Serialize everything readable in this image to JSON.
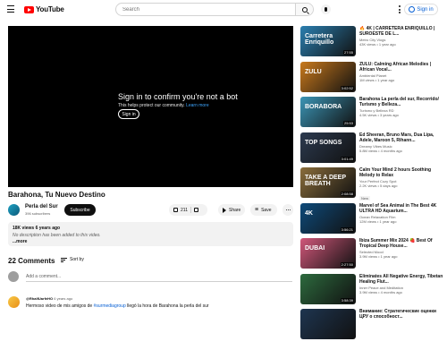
{
  "header": {
    "logo_text": "YouTube",
    "search_placeholder": "Search",
    "signin_label": "Sign in"
  },
  "player": {
    "message_title": "Sign in to confirm you're not a bot",
    "message_sub": "This helps protect our community.",
    "learn_more": "Learn more",
    "signin_button": "Sign in"
  },
  "video": {
    "title": "Barahona, Tu Nuevo Destino",
    "channel_name": "Perla del Sur",
    "channel_subs": "396 subscribers",
    "subscribe_label": "Subscribe",
    "likes": "211",
    "share_label": "Share",
    "save_label": "Save"
  },
  "description": {
    "meta": "18K views  6 years ago",
    "text": "No description has been added to this video.",
    "more": "...more"
  },
  "comments": {
    "count_label": "22 Comments",
    "sort_label": "Sort by",
    "add_placeholder": "Add a comment...",
    "first": {
      "author": "@RhalfUarfeHO",
      "when": "6 years ago",
      "text_before": "Hermoso video de mis amigos de ",
      "tag": "#surmediagroup",
      "text_after": " llegó la hora de Barahona la perla del sur"
    }
  },
  "recommendations": [
    {
      "title": "🔥 4K | CARRETERA ENRIQUILLO | SUROESTE DE L...",
      "channel": "Metro City Vlogs",
      "stats": "43K views • 1 year ago",
      "duration": "27:55",
      "thumb_label": "Carretera Enriquillo",
      "thumb_color": "#2b7fb0"
    },
    {
      "title": "ZULU: Calming African Melodies | African Vocal...",
      "channel": "Ambiental Planet",
      "stats": "1M views • 1 year ago",
      "duration": "3:02:52",
      "thumb_label": "ZULU",
      "thumb_color": "#c9791c"
    },
    {
      "title": "Barahona La perla del sur, Recorrido/ Turismo y Belleza...",
      "channel": "Turismo y Belleza RD",
      "stats": "4.5K views • 3 years ago",
      "duration": "25:53",
      "thumb_label": "BORABORA",
      "thumb_color": "#3b95b6"
    },
    {
      "title": "Ed Sheeran, Bruno Mars, Dua Lipa, Adele, Maroon 5, Rihann...",
      "channel": "Dreamy Vibes Music",
      "stats": "5.8M views • 4 months ago",
      "duration": "3:01:49",
      "thumb_label": "TOP SONGS",
      "thumb_color": "#2c3a4f"
    },
    {
      "title": "Calm Your Mind 2 hours Soothing Melody to Relax",
      "channel": "Your Perfect Cozy Spot",
      "stats": "2.2K views • 5 days ago",
      "duration": "2:08:58",
      "thumb_label": "TAKE A DEEP BREATH",
      "thumb_color": "#8a6d3b",
      "badge": "New"
    },
    {
      "title": "Marvel of Sea Animal in The Best 4K ULTRA HD Aquarium...",
      "channel": "Ocean Relaxation Film",
      "stats": "12M views • 1 year ago",
      "duration": "3:56:21",
      "thumb_label": "4K",
      "thumb_color": "#0e4a7a"
    },
    {
      "title": "Ibiza Summer Mix 2024 🍓 Best Of Tropical Deep House...",
      "channel": "Selected Mood",
      "stats": "3.9M views • 1 year ago",
      "duration": "2:27:50",
      "thumb_label": "DUBAI",
      "thumb_color": "#d1577a"
    },
    {
      "title": "Eliminates All Negative Energy, Tibetan Healing Flut...",
      "channel": "Inner Peace and Meditation",
      "stats": "3.9M views • 4 months ago",
      "duration": "3:58:39",
      "thumb_label": "",
      "thumb_color": "#2d6a3e"
    },
    {
      "title": "Внимание: Стратегические оценки ЦРУ о способност...",
      "channel": "",
      "stats": "",
      "duration": "",
      "thumb_label": "",
      "thumb_color": "#1e3550"
    }
  ]
}
